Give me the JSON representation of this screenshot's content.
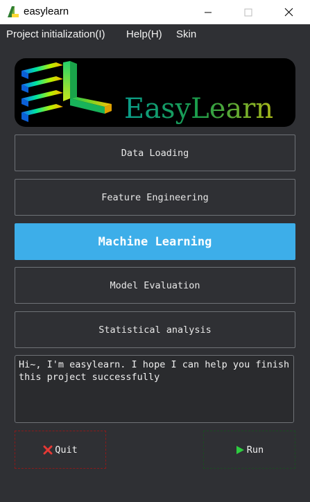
{
  "window": {
    "title": "easylearn",
    "controls": {
      "minimize": "minimize-icon",
      "maximize": "maximize-icon",
      "close": "close-icon"
    }
  },
  "menubar": {
    "items": [
      {
        "label": "Project initialization(I)"
      },
      {
        "label": "Help(H)"
      },
      {
        "label": "Skin"
      }
    ]
  },
  "banner": {
    "logo_text": "EasyLearn"
  },
  "nav": {
    "buttons": [
      {
        "label": "Data Loading",
        "active": false
      },
      {
        "label": "Feature Engineering",
        "active": false
      },
      {
        "label": "Machine Learning",
        "active": true
      },
      {
        "label": "Model Evaluation",
        "active": false
      },
      {
        "label": "Statistical analysis",
        "active": false
      }
    ]
  },
  "message": {
    "text": "Hi~, I'm easylearn. I hope I can help you finish\nthis project successfully"
  },
  "actions": {
    "quit": {
      "label": "Quit",
      "icon": "x-icon",
      "color": "#e53935"
    },
    "run": {
      "label": "Run",
      "icon": "play-icon",
      "color": "#2ecc40"
    }
  },
  "colors": {
    "accent": "#3daee9",
    "background": "#2f3034"
  }
}
